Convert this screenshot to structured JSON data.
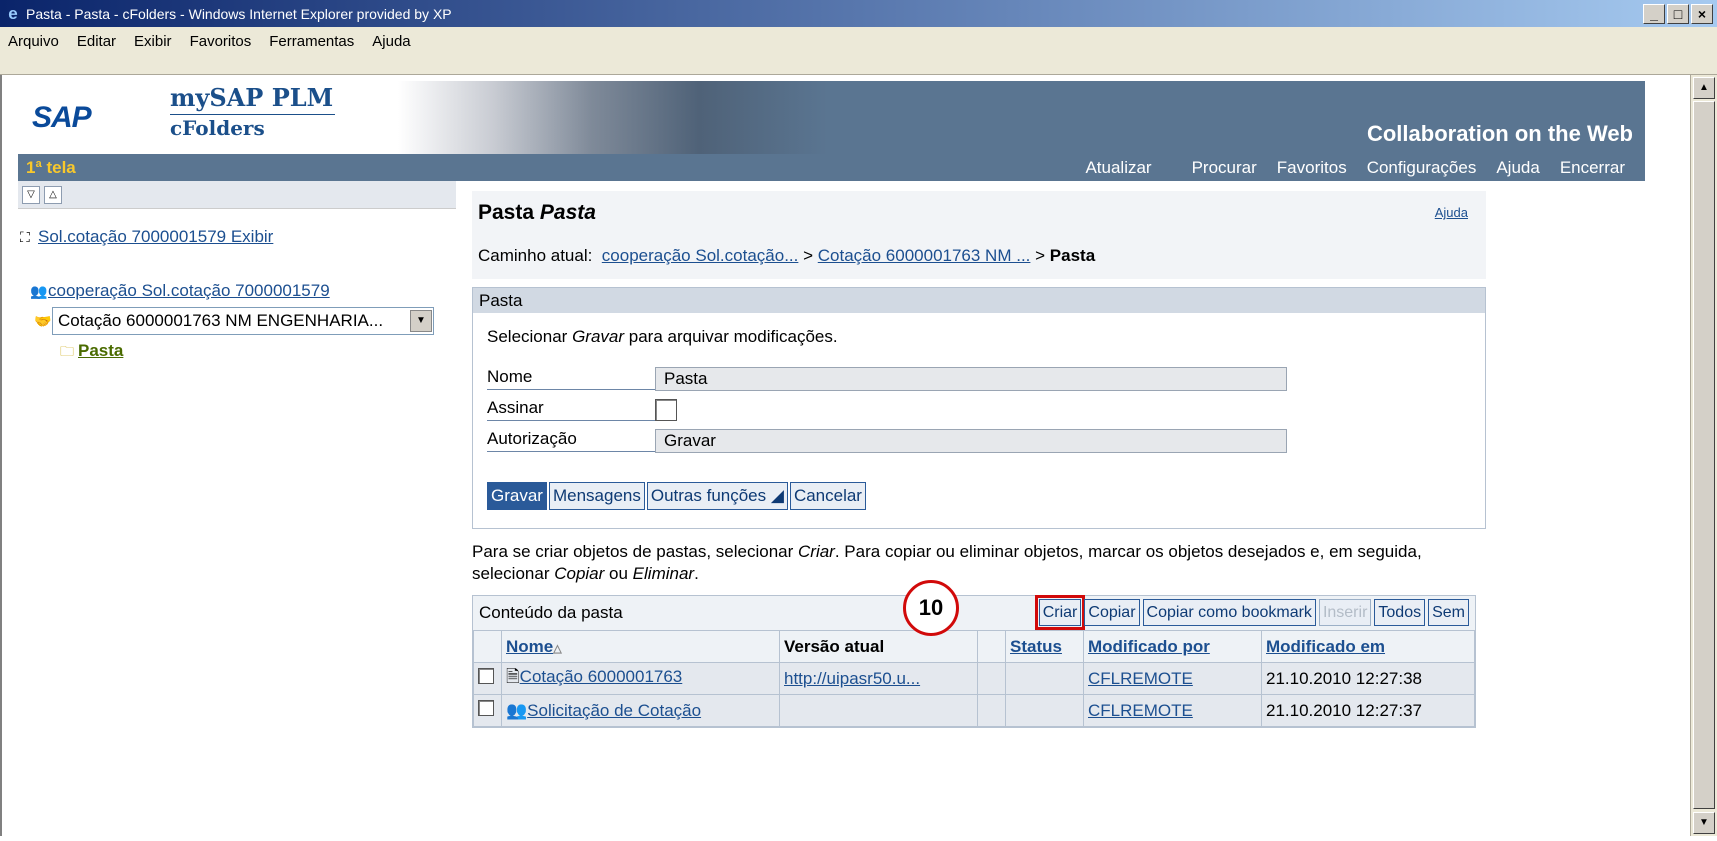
{
  "window": {
    "title": "Pasta - Pasta - cFolders - Windows Internet Explorer provided by XP"
  },
  "menubar": [
    "Arquivo",
    "Editar",
    "Exibir",
    "Favoritos",
    "Ferramentas",
    "Ajuda"
  ],
  "header": {
    "logo": "SAP",
    "product": "mySAP PLM",
    "module": "cFolders",
    "tagline": "Collaboration on the Web"
  },
  "nav": {
    "screen": "1ª tela",
    "links": [
      "Atualizar",
      "Procurar",
      "Favoritos",
      "Configurações",
      "Ajuda",
      "Encerrar"
    ]
  },
  "tree": {
    "root": "Sol.cotação 7000001579 Exibir",
    "collab": "cooperação Sol.cotação 7000001579",
    "select": "Cotação 6000001763 NM ENGENHARIA...",
    "folder": "Pasta"
  },
  "main": {
    "title_prefix": "Pasta",
    "title_name": "Pasta",
    "help": "Ajuda",
    "path_label": "Caminho atual:",
    "path1": "cooperação Sol.cotação...",
    "sep": " > ",
    "path2": "Cotação 6000001763 NM ...",
    "path3": "Pasta",
    "section_title": "Pasta",
    "instr_pre": "Selecionar ",
    "instr_em": "Gravar",
    "instr_post": " para arquivar modificações.",
    "fields": {
      "nome_label": "Nome",
      "nome_value": "Pasta",
      "assinar_label": "Assinar",
      "aut_label": "Autorização",
      "aut_value": "Gravar"
    },
    "buttons": {
      "gravar": "Gravar",
      "mensagens": "Mensagens",
      "outras": "Outras funções ◢",
      "cancelar": "Cancelar"
    },
    "info1": "Para se criar objetos de pastas, selecionar ",
    "info_criar": "Criar",
    "info2": ". Para copiar ou eliminar objetos, marcar os objetos desejados e, em seguida, selecionar ",
    "info_copiar": "Copiar",
    "info3": " ou ",
    "info_eliminar": "Eliminar",
    "info4": ".",
    "table_title": "Conteúdo da pasta",
    "table_buttons": {
      "criar": "Criar",
      "copiar": "Copiar",
      "bookmark": "Copiar como bookmark",
      "inserir": "Inserir",
      "todos": "Todos",
      "sem": "Sem"
    },
    "columns": {
      "nome": "Nome",
      "versao": "Versão atual",
      "status": "Status",
      "modpor": "Modificado por",
      "modem": "Modificado em"
    },
    "rows": [
      {
        "nome": "Cotação 6000001763",
        "versao": "http://uipasr50.u...",
        "status": "",
        "modpor": "CFLREMOTE",
        "modem": "21.10.2010 12:27:38"
      },
      {
        "nome": "Solicitação de Cotação",
        "versao": "",
        "status": "",
        "modpor": "CFLREMOTE",
        "modem": "21.10.2010 12:27:37"
      }
    ]
  },
  "callout": "10"
}
